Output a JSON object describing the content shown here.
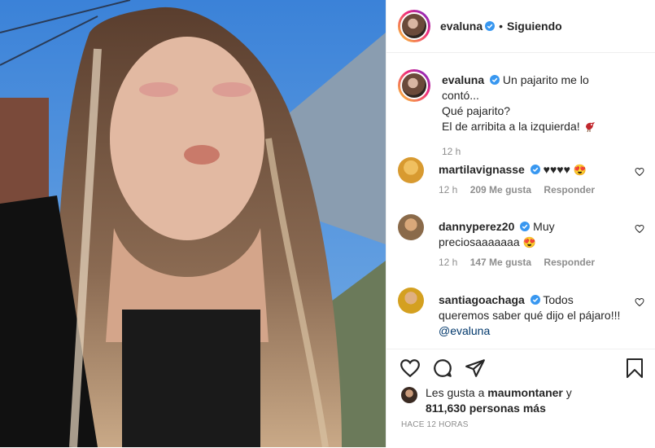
{
  "post": {
    "author": "evaluna",
    "follow_status": "Siguiendo",
    "caption_lines": [
      "Un pajarito me lo contó...",
      "Qué pajarito?",
      "El de arribita a la izquierda!"
    ],
    "caption_time": "12 h",
    "time_ago": "HACE 12 HORAS"
  },
  "comments": [
    {
      "user": "martilavignasse",
      "text": "♥♥♥♥",
      "time": "12 h",
      "likes": "209 Me gusta",
      "reply": "Responder"
    },
    {
      "user": "dannyperez20",
      "text": "Muy preciosaaaaaaa",
      "time": "12 h",
      "likes": "147 Me gusta",
      "reply": "Responder"
    },
    {
      "user": "santiagoachaga",
      "text": "Todos queremos saber qué dijo el pájaro!!!",
      "mention": "@evaluna"
    }
  ],
  "likes": {
    "prefix": "Les gusta a",
    "user": "maumontaner",
    "connector": "y",
    "count": "811,630 personas más"
  },
  "icons": [
    "heart-icon",
    "comment-icon",
    "share-icon",
    "bookmark-icon",
    "verified-icon",
    "bird-emoji",
    "heart-eyes-emoji"
  ],
  "colors": {
    "verified": "#3897f0",
    "text": "#262626",
    "muted": "#8e8e8e"
  }
}
